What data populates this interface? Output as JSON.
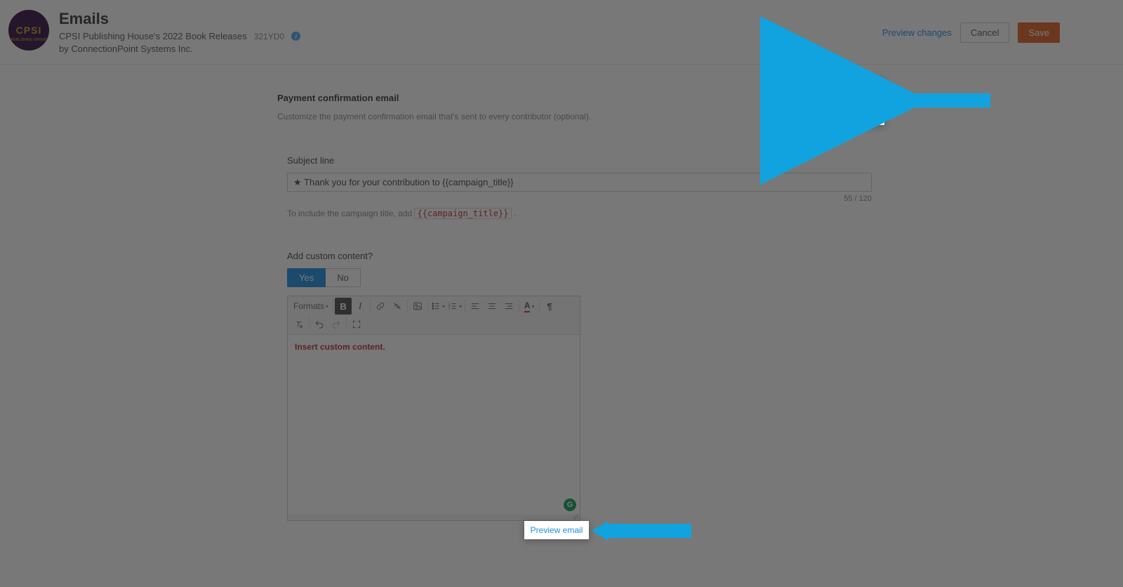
{
  "header": {
    "logo_text": "CPSI",
    "title": "Emails",
    "campaign_name": "CPSI Publishing House's 2022 Book Releases",
    "campaign_code": "321YD0",
    "byline": "by ConnectionPoint Systems Inc.",
    "preview_changes": "Preview changes",
    "cancel": "Cancel",
    "save": "Save"
  },
  "section": {
    "title": "Payment confirmation email",
    "desc": "Customize the payment confirmation email that's sent to every contributor (optional)."
  },
  "subject": {
    "label": "Subject line",
    "value": "★ Thank you for your contribution to {{campaign_title}}",
    "count": "55 / 120",
    "helper_prefix": "To include the campaign title, add ",
    "helper_code": "{{campaign_title}}",
    "helper_suffix": " ."
  },
  "custom": {
    "label": "Add custom content?",
    "yes": "Yes",
    "no": "No"
  },
  "editor": {
    "formats": "Formats",
    "placeholder": "Insert custom content.",
    "grammarly": "G"
  },
  "highlights": {
    "preview_email_btn": "Preview email",
    "preview_email_link": "Preview email"
  }
}
